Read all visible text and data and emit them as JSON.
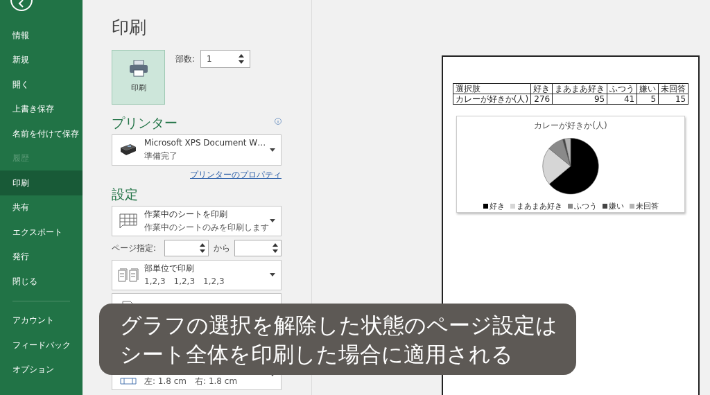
{
  "sidebar": {
    "items": [
      {
        "label": "情報",
        "selected": false,
        "disabled": false
      },
      {
        "label": "新規",
        "selected": false,
        "disabled": false
      },
      {
        "label": "開く",
        "selected": false,
        "disabled": false
      },
      {
        "label": "上書き保存",
        "selected": false,
        "disabled": false
      },
      {
        "label": "名前を付けて保存",
        "selected": false,
        "disabled": false
      },
      {
        "label": "履歴",
        "selected": false,
        "disabled": true
      },
      {
        "label": "印刷",
        "selected": true,
        "disabled": false
      },
      {
        "label": "共有",
        "selected": false,
        "disabled": false
      },
      {
        "label": "エクスポート",
        "selected": false,
        "disabled": false
      },
      {
        "label": "発行",
        "selected": false,
        "disabled": false
      },
      {
        "label": "閉じる",
        "selected": false,
        "disabled": false
      }
    ],
    "footer_items": [
      {
        "label": "アカウント",
        "selected": false
      },
      {
        "label": "フィードバック",
        "selected": false
      },
      {
        "label": "オプション",
        "selected": false
      }
    ]
  },
  "title": "印刷",
  "print_button": "印刷",
  "copies": {
    "label": "部数:",
    "value": "1"
  },
  "printer": {
    "heading": "プリンター",
    "name": "Microsoft XPS Document W…",
    "status": "準備完了",
    "properties_link": "プリンターのプロパティ"
  },
  "settings": {
    "heading": "設定",
    "what": {
      "title": "作業中のシートを印刷",
      "subtitle": "作業中のシートのみを印刷します"
    },
    "pages": {
      "label": "ページ指定:",
      "to_label": "から"
    },
    "collate": {
      "title": "部単位で印刷",
      "subtitle": "1,2,3　1,2,3　1,2,3"
    },
    "margins": {
      "subtitle": "左:  1.8 cm　右:  1.8 cm"
    }
  },
  "preview": {
    "table": {
      "header": [
        "選択肢",
        "好き",
        "まあまあ好き",
        "ふつう",
        "嫌い",
        "未回答"
      ],
      "row": [
        "カレーが好きか(人)",
        "276",
        "95",
        "41",
        "5",
        "15"
      ]
    },
    "chart_data": {
      "type": "pie",
      "title": "カレーが好きか(人)",
      "categories": [
        "好き",
        "まあまあ好き",
        "ふつう",
        "嫌い",
        "未回答"
      ],
      "values": [
        63.9,
        22.0,
        9.5,
        1.2,
        3.4
      ],
      "legend": "bottom"
    }
  },
  "caption": [
    "グラフの選択を解除した状態のページ設定は",
    "シート全体を印刷した場合に適用される"
  ]
}
